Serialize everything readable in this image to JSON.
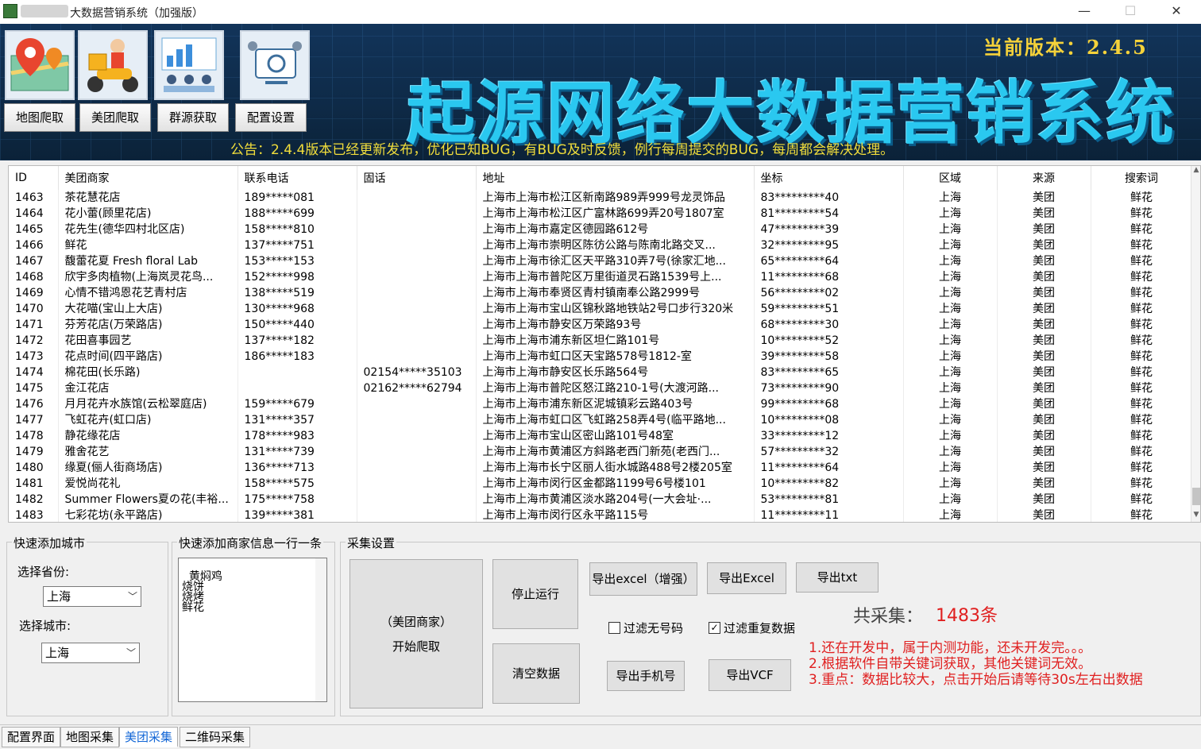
{
  "window": {
    "title": "大数据营销系统（加强版）",
    "minimize": "—",
    "maximize": "☐",
    "close": "✕"
  },
  "banner": {
    "version": "当前版本：2.4.5",
    "title": "起源网络大数据营销系统",
    "notice": "公告：2.4.4版本已经更新发布，优化已知BUG，有BUG及时反馈，例行每周提交的BUG，每周都会解决处理。",
    "nav": [
      "地图爬取",
      "美团爬取",
      "群源获取",
      "配置设置"
    ]
  },
  "table": {
    "headers": [
      "ID",
      "美团商家",
      "联系电话",
      "固话",
      "地址",
      "坐标",
      "区域",
      "来源",
      "搜索词"
    ],
    "rows": [
      [
        "1463",
        "茶花慧花店",
        "189*****081",
        "",
        "上海市上海市松江区新南路989弄999号龙灵饰品",
        "83*********40",
        "上海",
        "美团",
        "鲜花"
      ],
      [
        "1464",
        "花小蕾(顾里花店)",
        "188*****699",
        "",
        "上海市上海市松江区广富林路699弄20号1807室",
        "81*********54",
        "上海",
        "美团",
        "鲜花"
      ],
      [
        "1465",
        "花先生(德华四村北区店)",
        "158*****810",
        "",
        "上海市上海市嘉定区德园路612号",
        "47*********39",
        "上海",
        "美团",
        "鲜花"
      ],
      [
        "1466",
        "鲜花",
        "137*****751",
        "",
        "上海市上海市崇明区陈彷公路与陈南北路交叉...",
        "32*********95",
        "上海",
        "美团",
        "鲜花"
      ],
      [
        "1467",
        "馥蕾花夏 Fresh floral Lab",
        "153*****153",
        "",
        "上海市上海市徐汇区天平路310弄7号(徐家汇地...",
        "65*********64",
        "上海",
        "美团",
        "鲜花"
      ],
      [
        "1468",
        "欣宇多肉植物(上海岚灵花鸟...",
        "152*****998",
        "",
        "上海市上海市普陀区万里街道灵石路1539号上...",
        "11*********68",
        "上海",
        "美团",
        "鲜花"
      ],
      [
        "1469",
        "心情不错鸿恩花艺青村店",
        "138*****519",
        "",
        "上海市上海市奉贤区青村镇南奉公路2999号",
        "56*********02",
        "上海",
        "美团",
        "鲜花"
      ],
      [
        "1470",
        "大花喵(宝山上大店)",
        "130*****968",
        "",
        "上海市上海市宝山区锦秋路地铁站2号口步行320米",
        "59*********51",
        "上海",
        "美团",
        "鲜花"
      ],
      [
        "1471",
        "芬芳花店(万荣路店)",
        "150*****440",
        "",
        "上海市上海市静安区万荣路93号",
        "68*********30",
        "上海",
        "美团",
        "鲜花"
      ],
      [
        "1472",
        "花田喜事园艺",
        "137*****182",
        "",
        "上海市上海市浦东新区坦仁路101号",
        "10*********52",
        "上海",
        "美团",
        "鲜花"
      ],
      [
        "1473",
        "花点时间(四平路店)",
        "186*****183",
        "",
        "上海市上海市虹口区天宝路578号1812-室",
        "39*********58",
        "上海",
        "美团",
        "鲜花"
      ],
      [
        "1474",
        "棉花田(长乐路)",
        "",
        "02154*****35103",
        "上海市上海市静安区长乐路564号",
        "83*********65",
        "上海",
        "美团",
        "鲜花"
      ],
      [
        "1475",
        "金江花店",
        "",
        "02162*****62794",
        "上海市上海市普陀区怒江路210-1号(大渡河路...",
        "73*********90",
        "上海",
        "美团",
        "鲜花"
      ],
      [
        "1476",
        "月月花卉水族馆(云松翠庭店)",
        "159*****679",
        "",
        "上海市上海市浦东新区泥城镇彩云路403号",
        "99*********68",
        "上海",
        "美团",
        "鲜花"
      ],
      [
        "1477",
        "飞虹花卉(虹口店)",
        "131*****357",
        "",
        "上海市上海市虹口区飞虹路258弄4号(临平路地...",
        "10*********08",
        "上海",
        "美团",
        "鲜花"
      ],
      [
        "1478",
        "静花缘花店",
        "178*****983",
        "",
        "上海市上海市宝山区密山路101号48室",
        "33*********12",
        "上海",
        "美团",
        "鲜花"
      ],
      [
        "1479",
        "雅舍花艺",
        "131*****739",
        "",
        "上海市上海市黄浦区方斜路老西门新苑(老西门...",
        "57*********32",
        "上海",
        "美团",
        "鲜花"
      ],
      [
        "1480",
        "缘夏(俪人街商场店)",
        "136*****713",
        "",
        "上海市上海市长宁区丽人街水城路488号2楼205室",
        "11*********64",
        "上海",
        "美团",
        "鲜花"
      ],
      [
        "1481",
        "爱悦尚花礼",
        "158*****575",
        "",
        "上海市上海市闵行区金都路1199号6号楼101",
        "10*********82",
        "上海",
        "美团",
        "鲜花"
      ],
      [
        "1482",
        "Summer Flowers夏の花(丰裕...",
        "175*****758",
        "",
        "上海市上海市黄浦区淡水路204号(一大会址·...",
        "53*********81",
        "上海",
        "美团",
        "鲜花"
      ],
      [
        "1483",
        "七彩花坊(永平路店)",
        "139*****381",
        "",
        "上海市上海市闵行区永平路115号",
        "11*********11",
        "上海",
        "美团",
        "鲜花"
      ]
    ]
  },
  "city_panel": {
    "title": "快速添加城市",
    "province_label": "选择省份:",
    "province_value": "上海",
    "city_label": "选择城市:",
    "city_value": "上海"
  },
  "merchant_panel": {
    "title": "快速添加商家信息一行一条",
    "text": "黄焖鸡\n烧饼\n烧烤\n鲜花"
  },
  "collect_panel": {
    "title": "采集设置",
    "start_line1": "（美团商家）",
    "start_line2": "开始爬取",
    "stop": "停止运行",
    "clear": "清空数据",
    "export_excel_plus": "导出excel（增强）",
    "export_excel": "导出Excel",
    "export_txt": "导出txt",
    "filter_no_phone": "过滤无号码",
    "filter_no_phone_checked": false,
    "filter_dup": "过滤重复数据",
    "filter_dup_checked": true,
    "export_phone": "导出手机号",
    "export_vcf": "导出VCF",
    "total_label": "共采集：",
    "total_value": "1483条",
    "notes": [
      "1.还在开发中，属于内测功能，还未开发完。。。",
      "2.根据软件自带关键词获取，其他关键词无效。",
      "3.重点：数据比较大，点击开始后请等待30s左右出数据"
    ]
  },
  "tabs": [
    "配置界面",
    "地图采集",
    "美团采集",
    "二维码采集"
  ],
  "active_tab": "美团采集"
}
